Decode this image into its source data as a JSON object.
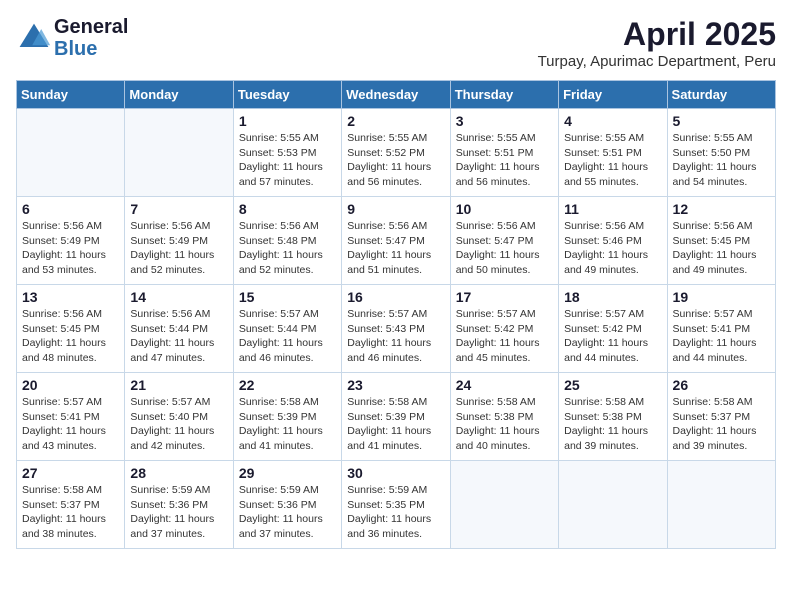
{
  "header": {
    "logo_line1": "General",
    "logo_line2": "Blue",
    "title": "April 2025",
    "subtitle": "Turpay, Apurimac Department, Peru"
  },
  "weekdays": [
    "Sunday",
    "Monday",
    "Tuesday",
    "Wednesday",
    "Thursday",
    "Friday",
    "Saturday"
  ],
  "weeks": [
    [
      {
        "day": "",
        "info": ""
      },
      {
        "day": "",
        "info": ""
      },
      {
        "day": "1",
        "info": "Sunrise: 5:55 AM\nSunset: 5:53 PM\nDaylight: 11 hours and 57 minutes."
      },
      {
        "day": "2",
        "info": "Sunrise: 5:55 AM\nSunset: 5:52 PM\nDaylight: 11 hours and 56 minutes."
      },
      {
        "day": "3",
        "info": "Sunrise: 5:55 AM\nSunset: 5:51 PM\nDaylight: 11 hours and 56 minutes."
      },
      {
        "day": "4",
        "info": "Sunrise: 5:55 AM\nSunset: 5:51 PM\nDaylight: 11 hours and 55 minutes."
      },
      {
        "day": "5",
        "info": "Sunrise: 5:55 AM\nSunset: 5:50 PM\nDaylight: 11 hours and 54 minutes."
      }
    ],
    [
      {
        "day": "6",
        "info": "Sunrise: 5:56 AM\nSunset: 5:49 PM\nDaylight: 11 hours and 53 minutes."
      },
      {
        "day": "7",
        "info": "Sunrise: 5:56 AM\nSunset: 5:49 PM\nDaylight: 11 hours and 52 minutes."
      },
      {
        "day": "8",
        "info": "Sunrise: 5:56 AM\nSunset: 5:48 PM\nDaylight: 11 hours and 52 minutes."
      },
      {
        "day": "9",
        "info": "Sunrise: 5:56 AM\nSunset: 5:47 PM\nDaylight: 11 hours and 51 minutes."
      },
      {
        "day": "10",
        "info": "Sunrise: 5:56 AM\nSunset: 5:47 PM\nDaylight: 11 hours and 50 minutes."
      },
      {
        "day": "11",
        "info": "Sunrise: 5:56 AM\nSunset: 5:46 PM\nDaylight: 11 hours and 49 minutes."
      },
      {
        "day": "12",
        "info": "Sunrise: 5:56 AM\nSunset: 5:45 PM\nDaylight: 11 hours and 49 minutes."
      }
    ],
    [
      {
        "day": "13",
        "info": "Sunrise: 5:56 AM\nSunset: 5:45 PM\nDaylight: 11 hours and 48 minutes."
      },
      {
        "day": "14",
        "info": "Sunrise: 5:56 AM\nSunset: 5:44 PM\nDaylight: 11 hours and 47 minutes."
      },
      {
        "day": "15",
        "info": "Sunrise: 5:57 AM\nSunset: 5:44 PM\nDaylight: 11 hours and 46 minutes."
      },
      {
        "day": "16",
        "info": "Sunrise: 5:57 AM\nSunset: 5:43 PM\nDaylight: 11 hours and 46 minutes."
      },
      {
        "day": "17",
        "info": "Sunrise: 5:57 AM\nSunset: 5:42 PM\nDaylight: 11 hours and 45 minutes."
      },
      {
        "day": "18",
        "info": "Sunrise: 5:57 AM\nSunset: 5:42 PM\nDaylight: 11 hours and 44 minutes."
      },
      {
        "day": "19",
        "info": "Sunrise: 5:57 AM\nSunset: 5:41 PM\nDaylight: 11 hours and 44 minutes."
      }
    ],
    [
      {
        "day": "20",
        "info": "Sunrise: 5:57 AM\nSunset: 5:41 PM\nDaylight: 11 hours and 43 minutes."
      },
      {
        "day": "21",
        "info": "Sunrise: 5:57 AM\nSunset: 5:40 PM\nDaylight: 11 hours and 42 minutes."
      },
      {
        "day": "22",
        "info": "Sunrise: 5:58 AM\nSunset: 5:39 PM\nDaylight: 11 hours and 41 minutes."
      },
      {
        "day": "23",
        "info": "Sunrise: 5:58 AM\nSunset: 5:39 PM\nDaylight: 11 hours and 41 minutes."
      },
      {
        "day": "24",
        "info": "Sunrise: 5:58 AM\nSunset: 5:38 PM\nDaylight: 11 hours and 40 minutes."
      },
      {
        "day": "25",
        "info": "Sunrise: 5:58 AM\nSunset: 5:38 PM\nDaylight: 11 hours and 39 minutes."
      },
      {
        "day": "26",
        "info": "Sunrise: 5:58 AM\nSunset: 5:37 PM\nDaylight: 11 hours and 39 minutes."
      }
    ],
    [
      {
        "day": "27",
        "info": "Sunrise: 5:58 AM\nSunset: 5:37 PM\nDaylight: 11 hours and 38 minutes."
      },
      {
        "day": "28",
        "info": "Sunrise: 5:59 AM\nSunset: 5:36 PM\nDaylight: 11 hours and 37 minutes."
      },
      {
        "day": "29",
        "info": "Sunrise: 5:59 AM\nSunset: 5:36 PM\nDaylight: 11 hours and 37 minutes."
      },
      {
        "day": "30",
        "info": "Sunrise: 5:59 AM\nSunset: 5:35 PM\nDaylight: 11 hours and 36 minutes."
      },
      {
        "day": "",
        "info": ""
      },
      {
        "day": "",
        "info": ""
      },
      {
        "day": "",
        "info": ""
      }
    ]
  ]
}
